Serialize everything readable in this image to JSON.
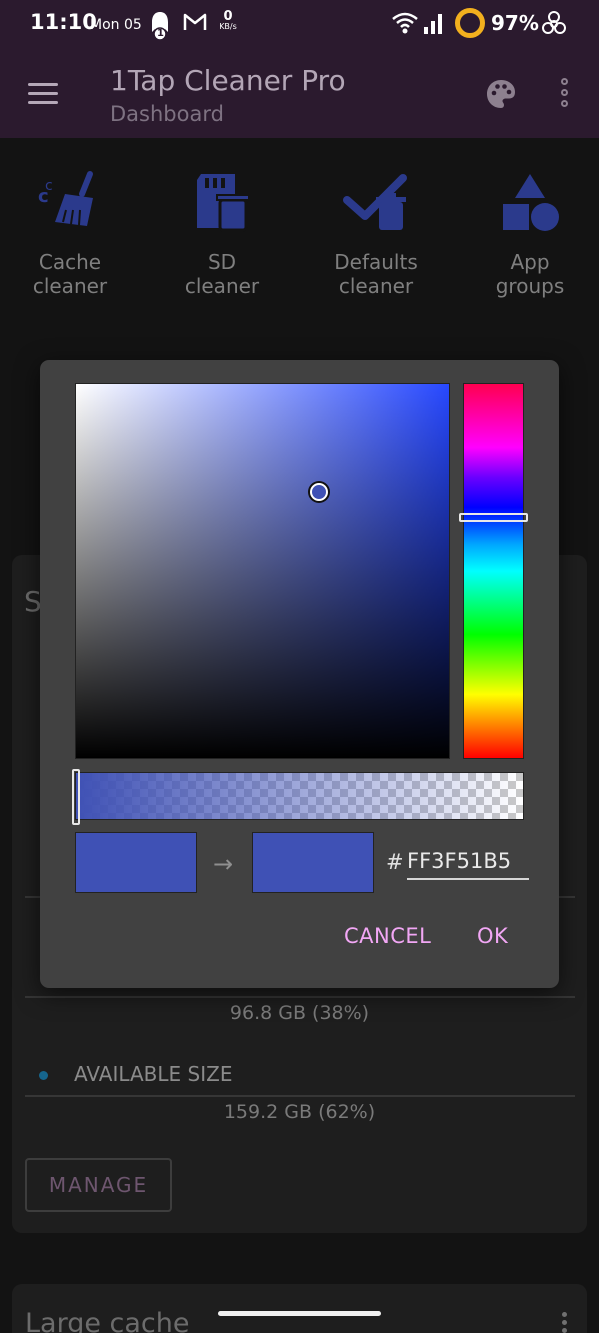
{
  "status_bar": {
    "time": "11:10",
    "date": "Mon 05",
    "notification_badge": "1",
    "net_speed_value": "0",
    "net_speed_unit": "KB/s",
    "battery": "97%"
  },
  "app_bar": {
    "title": "1Tap Cleaner Pro",
    "subtitle": "Dashboard"
  },
  "tiles": [
    {
      "label_line1": "Cache",
      "label_line2": "cleaner",
      "icon": "broom-icon"
    },
    {
      "label_line1": "SD",
      "label_line2": "cleaner",
      "icon": "sd-card-trash-icon"
    },
    {
      "label_line1": "Defaults",
      "label_line2": "cleaner",
      "icon": "check-trash-icon"
    },
    {
      "label_line1": "App",
      "label_line2": "groups",
      "icon": "shapes-icon"
    }
  ],
  "storage_card": {
    "title_partial": "S",
    "used_value": "96.8 GB (38%)",
    "available_label": "AVAILABLE SIZE",
    "available_value": "159.2 GB (62%)",
    "manage_label": "MANAGE"
  },
  "large_cache_card": {
    "title": "Large cache"
  },
  "color_dialog": {
    "hue_fraction": 0.36,
    "saturation_fraction": 0.63,
    "value_fraction": 0.71,
    "alpha_fraction": 0.0,
    "old_color": "#3f51b5",
    "new_color": "#3f51b5",
    "hash_label": "#",
    "hex_value": "FF3F51B5",
    "cancel_label": "CANCEL",
    "ok_label": "OK"
  },
  "colors": {
    "app_bar_bg": "#2b1a2e",
    "tile_icon": "#2b3a8c",
    "dialog_bg": "#414141",
    "accent_button_text": "#f2a7f5",
    "battery_ring": "#f2b01e"
  }
}
